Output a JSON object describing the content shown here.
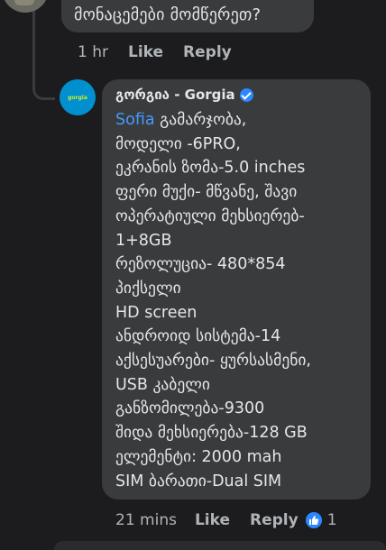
{
  "top_comment": {
    "text": "მონაცემები მომწერეთ?",
    "time": "1 hr",
    "like_label": "Like",
    "reply_label": "Reply"
  },
  "reply": {
    "avatar_text": "gorgia",
    "author": "გორგია - Gorgia",
    "verified": true,
    "mention": "Sofia",
    "first_line_rest": " გამარჯობა,",
    "lines": [
      "მოდელი -6PRO,",
      "ეკრანის ზომა-5.0 inches",
      "ფერი მუქი- მწვანე, შავი",
      "ოპერატიული მეხსიერებ-",
      "1+8GB",
      "რეზოლუცია- 480*854",
      "პიქსელი",
      "HD screen",
      "ანდროიდ სისტემა-14",
      "აქსესუარები- ყურსასმენი,",
      "USB კაბელი",
      "განზომილება-9300",
      "შიდა მეხსიერება-128 GB",
      "ელემენტი: 2000 mah",
      "SIM ბარათი-Dual SIM"
    ],
    "time": "21 mins",
    "like_label": "Like",
    "reply_label": "Reply",
    "like_count": "1"
  },
  "colors": {
    "background": "#1c1c1e",
    "bubble": "#3a3b3c",
    "mention": "#4599ff",
    "meta_text": "#b0b3b8",
    "like_badge": "#2d88ff"
  },
  "icons": {
    "verified": "verified-badge-icon",
    "like_reaction": "thumbs-up-icon"
  }
}
